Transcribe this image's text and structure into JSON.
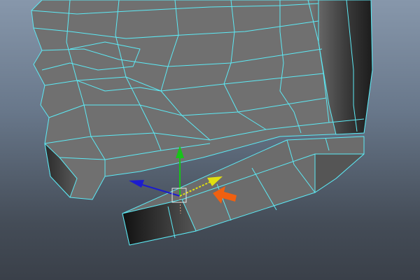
{
  "viewport": {
    "mesh_wire_color": "#5ceaf5",
    "mesh_fill_color": "#6e6e6e",
    "gizmo": {
      "y_axis_color": "#18c21a",
      "x_axis_color": "#1c1ccf",
      "z_axis_color": "#e0e010",
      "pointer_color": "#f06010"
    }
  }
}
